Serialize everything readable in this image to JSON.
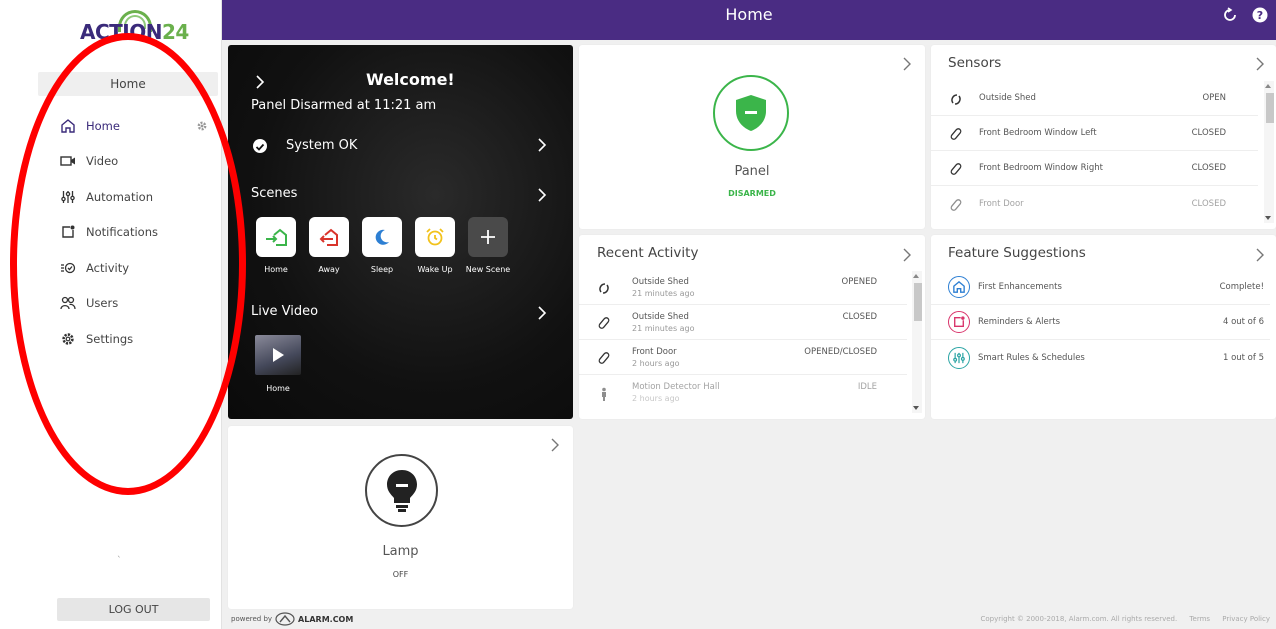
{
  "app": {
    "logo_text_a": "ACTION",
    "logo_text_b": "24",
    "header_title": "Home"
  },
  "sidebar": {
    "title": "Home",
    "items": [
      {
        "label": "Home",
        "icon": "home-icon",
        "active": true
      },
      {
        "label": "Video",
        "icon": "video-icon"
      },
      {
        "label": "Automation",
        "icon": "automation-icon"
      },
      {
        "label": "Notifications",
        "icon": "notifications-icon"
      },
      {
        "label": "Activity",
        "icon": "activity-icon"
      },
      {
        "label": "Users",
        "icon": "users-icon"
      },
      {
        "label": "Settings",
        "icon": "settings-icon"
      }
    ],
    "tick": "`",
    "logout": "LOG OUT"
  },
  "welcome": {
    "title": "Welcome!",
    "subtitle": "Panel Disarmed at 11:21 am",
    "system_status": "System OK",
    "scenes_label": "Scenes",
    "scenes": [
      {
        "label": "Home",
        "color": "#3bb54a"
      },
      {
        "label": "Away",
        "color": "#d9342b"
      },
      {
        "label": "Sleep",
        "color": "#2d7fd3"
      },
      {
        "label": "Wake Up",
        "color": "#f2c21b"
      },
      {
        "label": "New Scene",
        "color": "#ffffff"
      }
    ],
    "live_video_label": "Live Video",
    "video_label": "Home"
  },
  "panel": {
    "label": "Panel",
    "status": "DISARMED",
    "status_color": "#3bb54a"
  },
  "sensors": {
    "title": "Sensors",
    "rows": [
      {
        "name": "Outside Shed",
        "status": "OPEN",
        "icon": "open-sensor-icon"
      },
      {
        "name": "Front Bedroom Window Left",
        "status": "CLOSED",
        "icon": "closed-sensor-icon"
      },
      {
        "name": "Front Bedroom Window Right",
        "status": "CLOSED",
        "icon": "closed-sensor-icon"
      },
      {
        "name": "Front Door",
        "status": "CLOSED",
        "icon": "closed-sensor-icon"
      }
    ]
  },
  "activity": {
    "title": "Recent Activity",
    "rows": [
      {
        "name": "Outside Shed",
        "time": "21 minutes ago",
        "status": "OPENED",
        "icon": "open-sensor-icon"
      },
      {
        "name": "Outside Shed",
        "time": "21 minutes ago",
        "status": "CLOSED",
        "icon": "closed-sensor-icon"
      },
      {
        "name": "Front Door",
        "time": "2 hours ago",
        "status": "OPENED/CLOSED",
        "icon": "closed-sensor-icon"
      },
      {
        "name": "Motion Detector Hall",
        "time": "2 hours ago",
        "status": "IDLE",
        "icon": "motion-sensor-icon"
      }
    ]
  },
  "suggestions": {
    "title": "Feature Suggestions",
    "rows": [
      {
        "name": "First Enhancements",
        "status": "Complete!",
        "color": "#2d7fd3",
        "icon": "home-icon"
      },
      {
        "name": "Reminders & Alerts",
        "status": "4 out of 6",
        "color": "#d9346b",
        "icon": "notifications-icon"
      },
      {
        "name": "Smart Rules & Schedules",
        "status": "1 out of 5",
        "color": "#2aa4a4",
        "icon": "automation-icon"
      }
    ]
  },
  "lamp": {
    "label": "Lamp",
    "status": "OFF"
  },
  "footer": {
    "powered_by": "powered by",
    "brand": "ALARM.COM",
    "copyright": "Copyright © 2000-2018, Alarm.com. All rights reserved.",
    "terms": "Terms",
    "privacy": "Privacy Policy"
  },
  "colors": {
    "header": "#4a2c83",
    "brand_green": "#6ab04c",
    "annotation": "#ff0000"
  }
}
